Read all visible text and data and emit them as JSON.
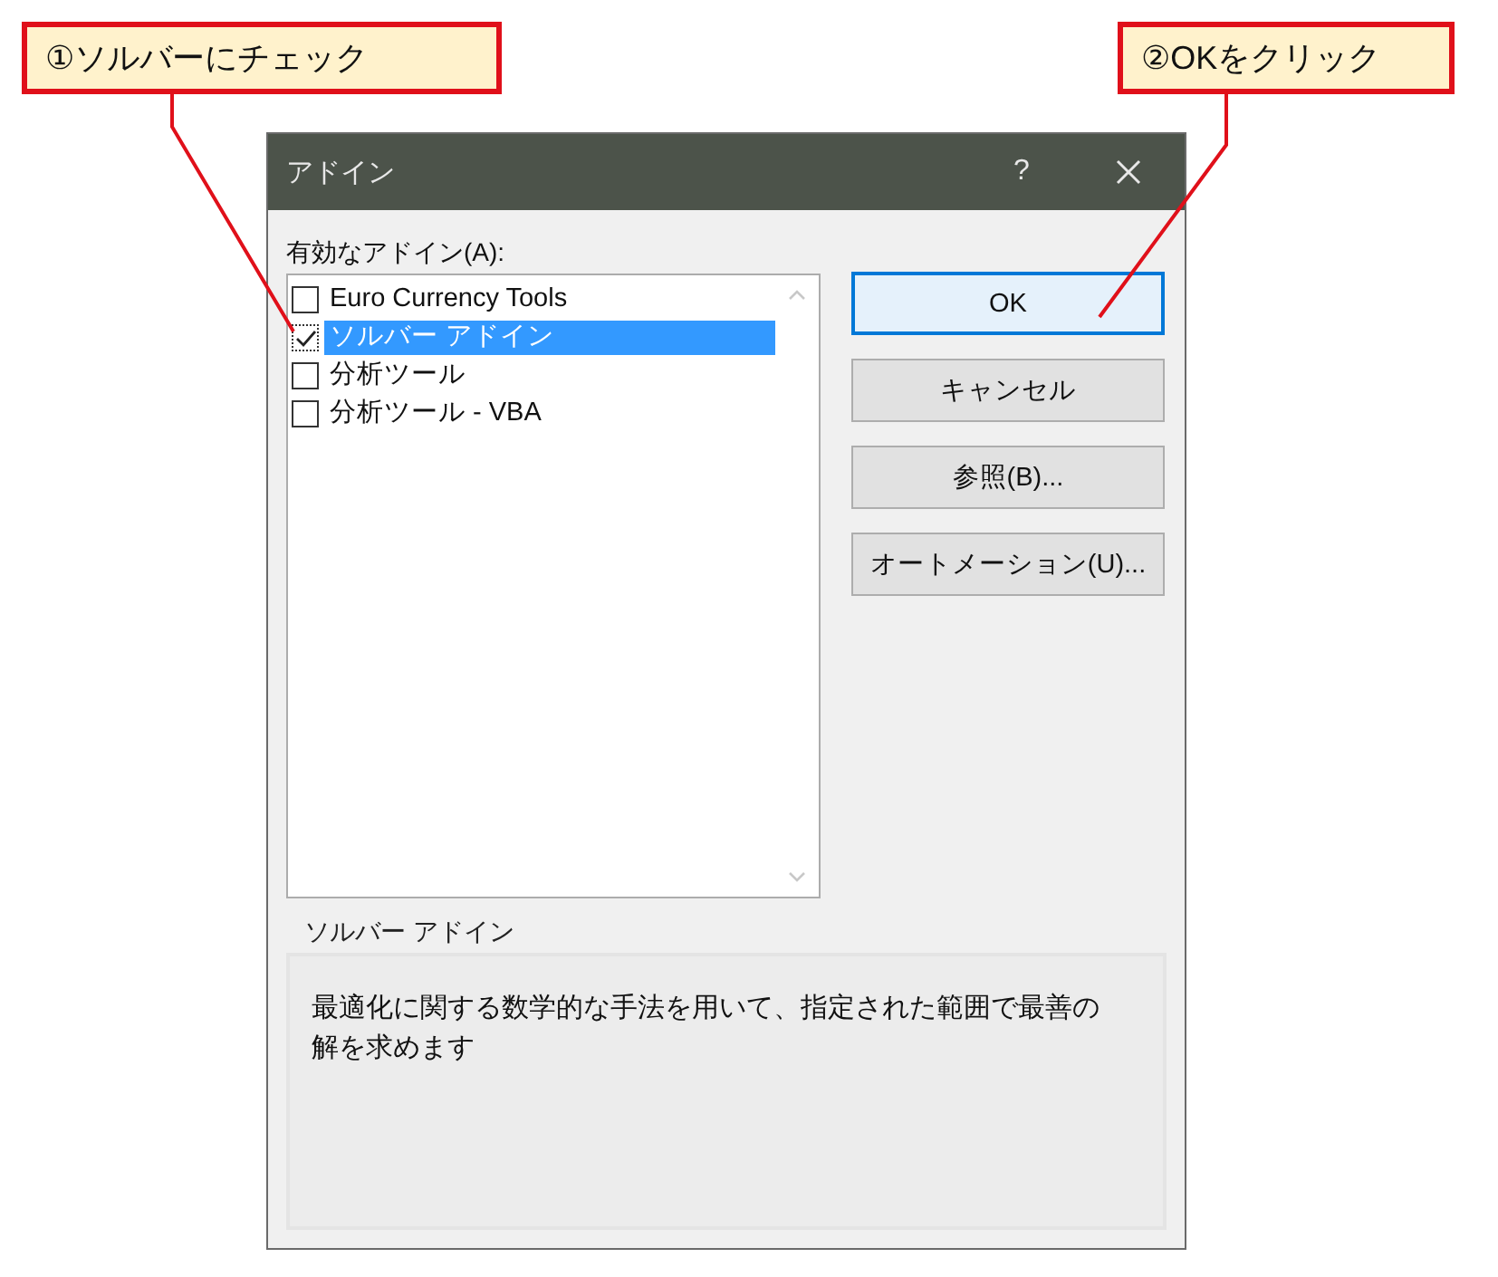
{
  "callouts": [
    {
      "text": "①ソルバーにチェック"
    },
    {
      "text": "②OKをクリック"
    }
  ],
  "dialog": {
    "title": "アドイン",
    "help": "?",
    "list_label": "有効なアドイン(A):",
    "items": [
      {
        "label": "Euro Currency Tools",
        "checked": false,
        "selected": false
      },
      {
        "label": "ソルバー アドイン",
        "checked": true,
        "selected": true
      },
      {
        "label": "分析ツール",
        "checked": false,
        "selected": false
      },
      {
        "label": "分析ツール - VBA",
        "checked": false,
        "selected": false
      }
    ],
    "buttons": [
      {
        "label": "OK",
        "default": true
      },
      {
        "label": "キャンセル",
        "default": false
      },
      {
        "label": "参照(B)...",
        "default": false
      },
      {
        "label": "オートメーション(U)...",
        "default": false
      }
    ],
    "description": {
      "title": "ソルバー アドイン",
      "text": "最適化に関する数学的な手法を用いて、指定された範囲で最善の解を求めます"
    }
  }
}
